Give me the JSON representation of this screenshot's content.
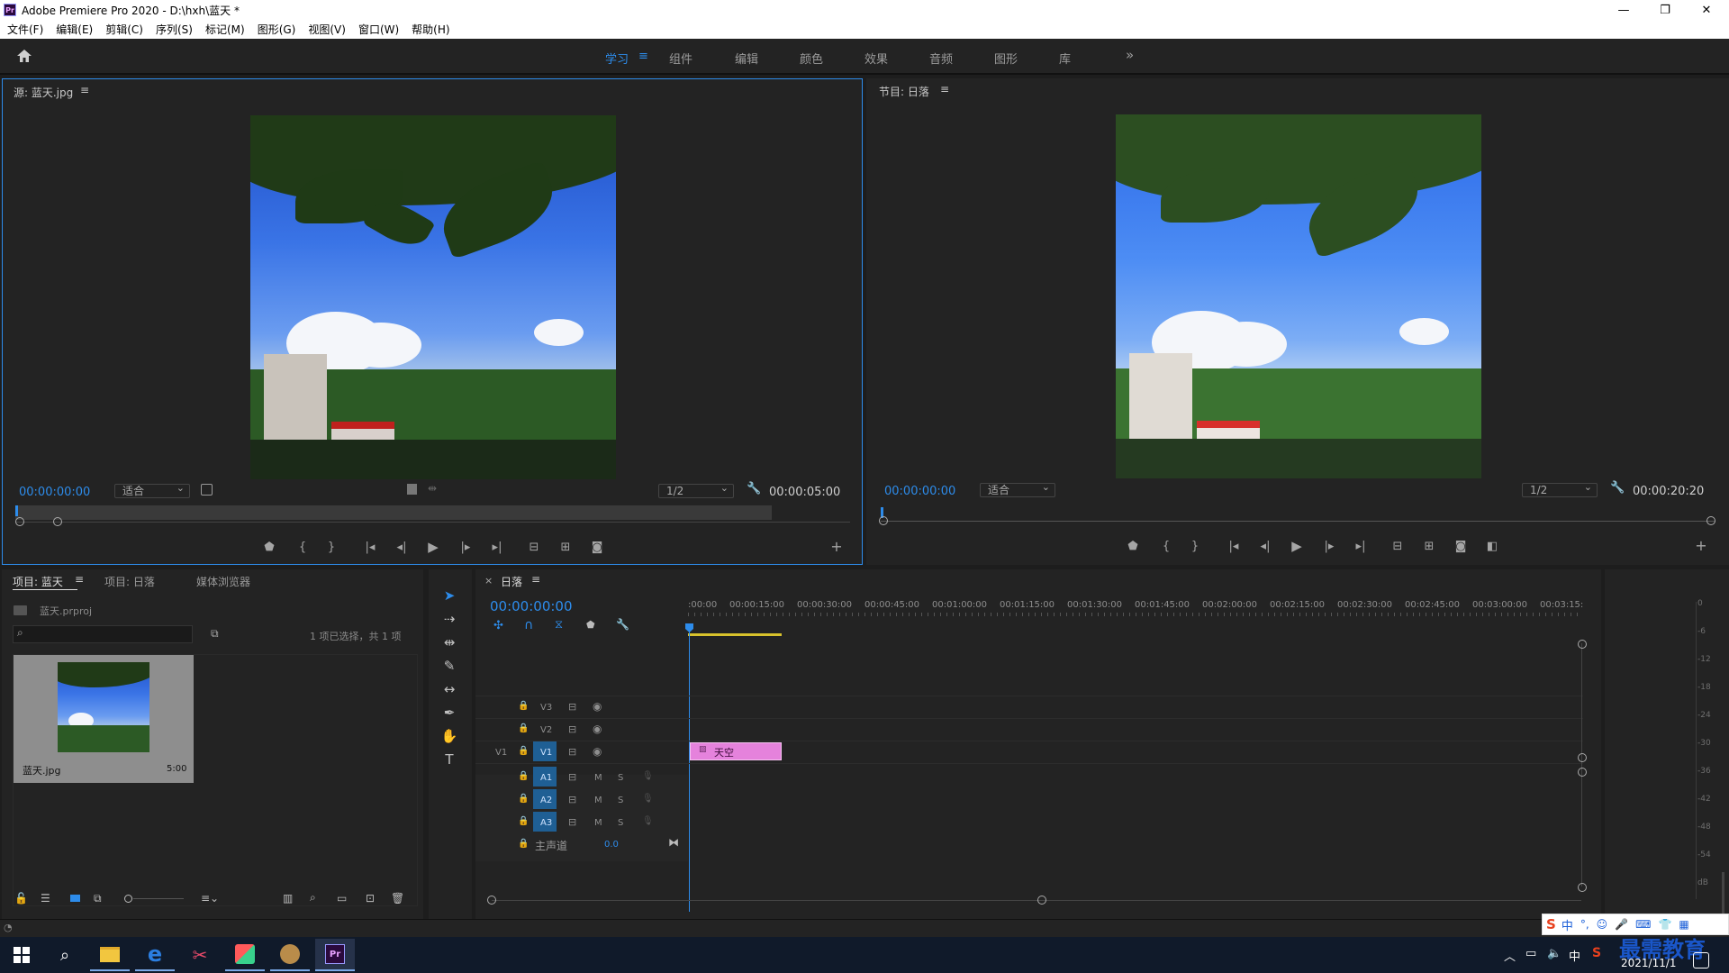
{
  "window": {
    "title": "Adobe Premiere Pro 2020 - D:\\hxh\\蓝天 *",
    "app_icon": "Pr"
  },
  "menu": [
    "文件(F)",
    "编辑(E)",
    "剪辑(C)",
    "序列(S)",
    "标记(M)",
    "图形(G)",
    "视图(V)",
    "窗口(W)",
    "帮助(H)"
  ],
  "workspaces": {
    "tabs": [
      "学习",
      "组件",
      "编辑",
      "颜色",
      "效果",
      "音频",
      "图形",
      "库"
    ],
    "active": "学习",
    "more": "»"
  },
  "source_monitor": {
    "title": "源: 蓝天.jpg",
    "timecode": "00:00:00:00",
    "zoom": "适合",
    "resolution": "1/2",
    "duration": "00:00:05:00"
  },
  "program_monitor": {
    "title": "节目: 日落",
    "timecode": "00:00:00:00",
    "zoom": "适合",
    "resolution": "1/2",
    "duration": "00:00:20:20"
  },
  "project": {
    "tabs": [
      "项目: 蓝天",
      "项目: 日落",
      "媒体浏览器"
    ],
    "file": "蓝天.prproj",
    "selection": "1 项已选择，共 1 项",
    "item_name": "蓝天.jpg",
    "item_duration": "5:00"
  },
  "timeline": {
    "title": "日落",
    "timecode": "00:00:00:00",
    "ruler": [
      ":00:00",
      "00:00:15:00",
      "00:00:30:00",
      "00:00:45:00",
      "00:01:00:00",
      "00:01:15:00",
      "00:01:30:00",
      "00:01:45:00",
      "00:02:00:00",
      "00:02:15:00",
      "00:02:30:00",
      "00:02:45:00",
      "00:03:00:00",
      "00:03:15:"
    ],
    "video_tracks": [
      "V3",
      "V2",
      "V1"
    ],
    "source_patch": "V1",
    "audio_tracks": [
      "A1",
      "A2",
      "A3"
    ],
    "mute": "M",
    "solo": "S",
    "master": {
      "label": "主声道",
      "value": "0.0"
    },
    "clip": "天空"
  },
  "audio_meter": {
    "labels": [
      "0",
      "-6",
      "-12",
      "-18",
      "-24",
      "-30",
      "-36",
      "-42",
      "-48",
      "-54",
      "dB"
    ]
  },
  "taskbar": {
    "date": "2021/11/1",
    "ime": "中",
    "watermark": "最需教育"
  },
  "colors": {
    "accent": "#2d8ceb",
    "clip": "#e582dc",
    "panel": "#232323",
    "bg": "#1d1d1d"
  }
}
